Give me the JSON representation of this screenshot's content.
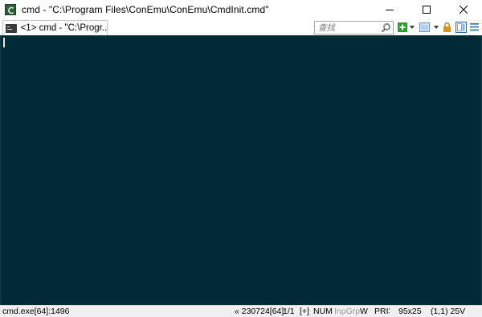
{
  "window": {
    "title": "cmd - \"C:\\Program Files\\ConEmu\\ConEmu\\CmdInit.cmd\"",
    "icon": "conemu-app-icon"
  },
  "tabs": [
    {
      "label": "<1> cmd - \"C:\\Progr...",
      "icon": "console-icon",
      "active": true
    }
  ],
  "toolbar": {
    "search_placeholder": "查找",
    "icons": [
      "search-icon",
      "new-console-icon",
      "dropdown-icon",
      "view-icon",
      "dropdown-icon",
      "lock-icon",
      "split-view-icon",
      "menu-icon"
    ]
  },
  "colors": {
    "console_bg": "#002b36",
    "new_console_green": "#2aa12a",
    "lock_orange": "#d89422",
    "accent_blue": "#2c6fb7"
  },
  "statusbar": {
    "process": "cmd.exe[64]:1496",
    "server": "« 230724[64]",
    "console_count": "1/1",
    "plus": "[+]",
    "num": "NUM",
    "inpgrp": "InpGrp",
    "w": "W",
    "priority": "PRI",
    "size": "95x25",
    "cursor_pos": "(1,1) 25V"
  }
}
